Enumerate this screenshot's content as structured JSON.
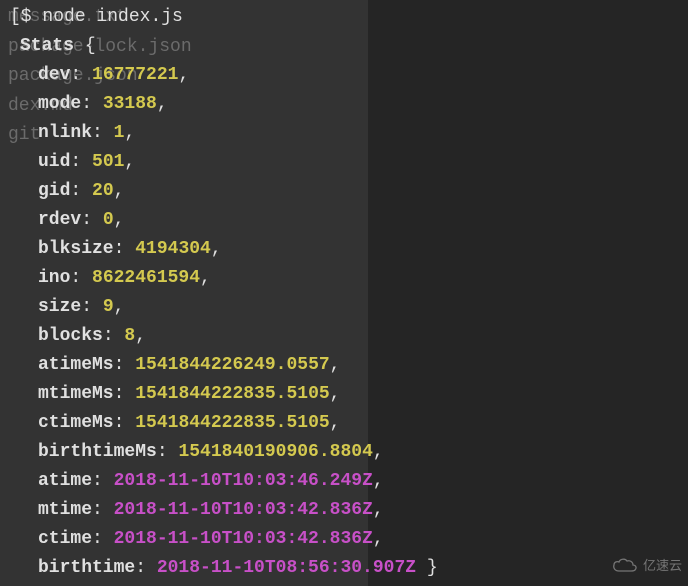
{
  "ghost": {
    "lines": [
      "message.txt",
      "",
      "package-lock.json",
      "",
      "package.json",
      "",
      "dex.md",
      "",
      "git"
    ]
  },
  "prompt": "[$",
  "command": "node index.js",
  "object_name": "Stats",
  "open_brace": " {",
  "close_brace": " }",
  "fields": [
    {
      "key": "dev",
      "value": "16777221",
      "type": "num"
    },
    {
      "key": "mode",
      "value": "33188",
      "type": "num"
    },
    {
      "key": "nlink",
      "value": "1",
      "type": "num"
    },
    {
      "key": "uid",
      "value": "501",
      "type": "num"
    },
    {
      "key": "gid",
      "value": "20",
      "type": "num"
    },
    {
      "key": "rdev",
      "value": "0",
      "type": "num"
    },
    {
      "key": "blksize",
      "value": "4194304",
      "type": "num"
    },
    {
      "key": "ino",
      "value": "8622461594",
      "type": "num"
    },
    {
      "key": "size",
      "value": "9",
      "type": "num"
    },
    {
      "key": "blocks",
      "value": "8",
      "type": "num"
    },
    {
      "key": "atimeMs",
      "value": "1541844226249.0557",
      "type": "num"
    },
    {
      "key": "mtimeMs",
      "value": "1541844222835.5105",
      "type": "num"
    },
    {
      "key": "ctimeMs",
      "value": "1541844222835.5105",
      "type": "num"
    },
    {
      "key": "birthtimeMs",
      "value": "1541840190906.8804",
      "type": "num"
    },
    {
      "key": "atime",
      "value": "2018-11-10T10:03:46.249Z",
      "type": "date"
    },
    {
      "key": "mtime",
      "value": "2018-11-10T10:03:42.836Z",
      "type": "date"
    },
    {
      "key": "ctime",
      "value": "2018-11-10T10:03:42.836Z",
      "type": "date"
    },
    {
      "key": "birthtime",
      "value": "2018-11-10T08:56:30.907Z",
      "type": "date"
    }
  ],
  "watermark": {
    "text": "亿速云"
  }
}
